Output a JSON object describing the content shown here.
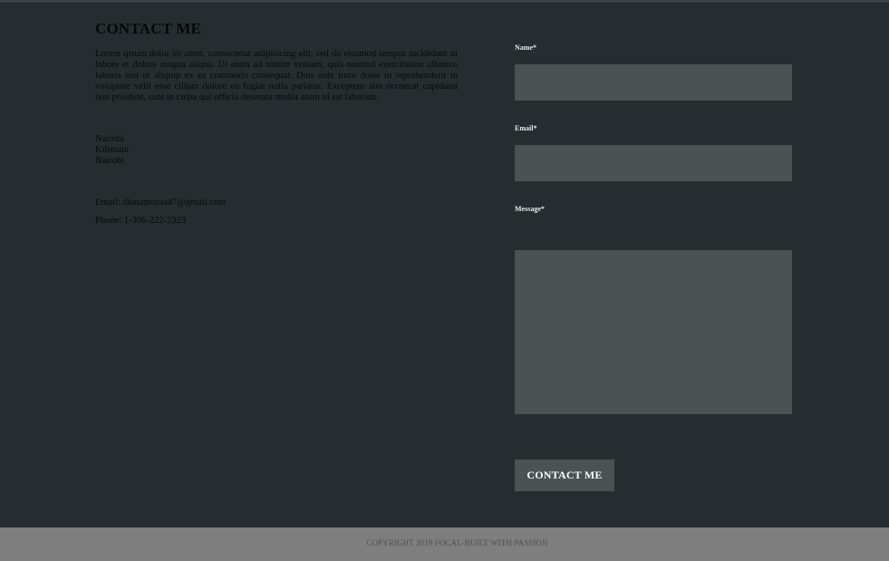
{
  "contact": {
    "heading": "CONTACT ME",
    "intro": "Lorem ipsum dolor sit amet, consectetur adipisicing elit, sed do eiusmod tempor incididunt ut labore et dolore magna aliqua. Ut enim ad minim veniam, quis nostrud exercitation ullamco laboris nisi ut aliquip ex ea commodo consequat. Duis aute irure dolor in reprehenderit in voluptate velit esse cillum dolore eu fugiat nulla pariatur. Excepteur sint occaecat cupidatat non proident, sunt in culpa qui officia deserunt mollit anim id est laborum.",
    "address": [
      "Nairobi",
      "Kilimani",
      "Nairobi"
    ],
    "email": "Email: dianamoraa47@gmail.com",
    "phone": "Phone: 1-306-222-2323"
  },
  "form": {
    "name_label": "Name*",
    "name_value": "",
    "email_label": "Email*",
    "email_value": "",
    "message_label": "Message*",
    "message_value": "",
    "submit_label": "CONTACT ME"
  },
  "footer": {
    "text": "COPYRIGHT 2019 FOCAL-BUILT WITH PASSION"
  },
  "colors": {
    "background": "#262d30",
    "input_background": "#4a5254",
    "footer_background": "#7e7e7e"
  }
}
